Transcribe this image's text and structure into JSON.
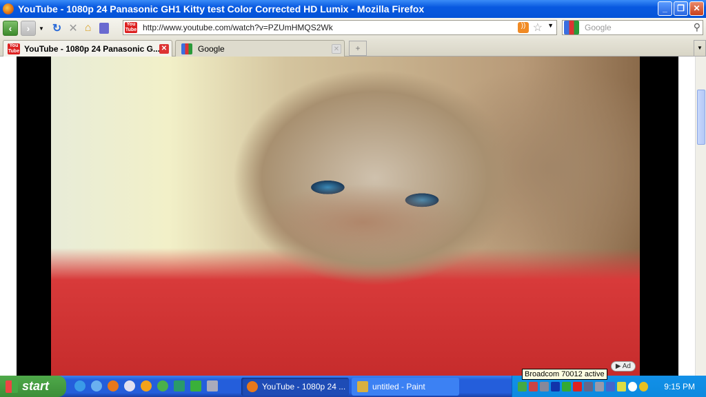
{
  "window": {
    "title": "YouTube - 1080p 24 Panasonic GH1 Kitty test Color Corrected HD Lumix - Mozilla Firefox",
    "minimize": "_",
    "restore": "❐",
    "close": "✕"
  },
  "nav": {
    "back": "‹",
    "forward": "›",
    "url": "http://www.youtube.com/watch?v=PZUmHMQS2Wk",
    "search_placeholder": "Google"
  },
  "tabs": [
    {
      "label": "YouTube - 1080p 24 Panasonic G...",
      "active": true
    },
    {
      "label": "Google",
      "active": false
    }
  ],
  "player": {
    "ad_label": "Ad"
  },
  "taskbar": {
    "start": "start",
    "windows": [
      {
        "label": "YouTube - 1080p 24 ..."
      },
      {
        "label": "untitled - Paint"
      }
    ],
    "clock": "9:15 PM",
    "tooltip": "Broadcom 70012 active"
  },
  "icons": {
    "yt_favicon": "You Tube"
  }
}
